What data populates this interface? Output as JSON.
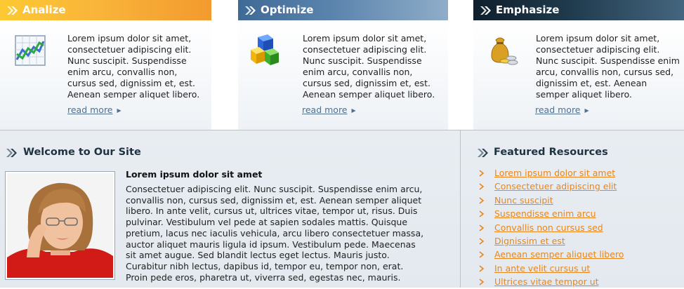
{
  "features": [
    {
      "title": "Analize",
      "icon": "chart-icon",
      "text": "Lorem ipsum dolor sit amet, consectetuer adipiscing elit. Nunc suscipit. Suspendisse enim arcu, convallis non, cursus sed, dignissim et, est. Aenean semper aliquet libero.",
      "link": "read more"
    },
    {
      "title": "Optimize",
      "icon": "cubes-icon",
      "text": "Lorem ipsum dolor sit amet, consectetuer adipiscing elit. Nunc suscipit. Suspendisse enim arcu, convallis non, cursus sed, dignissim et, est. Aenean semper aliquet libero.",
      "link": "read more"
    },
    {
      "title": "Emphasize",
      "icon": "money-bag-icon",
      "text": "Lorem ipsum dolor sit amet, consectetuer adipiscing elit. Nunc suscipit. Suspendisse enim arcu, convallis non, cursus sed, dignissim et, est. Aenean semper aliquet libero.",
      "link": "read more"
    }
  ],
  "welcome": {
    "title": "Welcome to Our Site",
    "heading": "Lorem ipsum dolor sit amet",
    "body": "Consectetuer adipiscing elit. Nunc suscipit. Suspendisse enim arcu, convallis non, cursus sed, dignissim et, est. Aenean semper aliquet libero. In ante velit, cursus ut, ultrices vitae, tempor ut, risus. Duis pulvinar. Vestibulum vel pede at sapien sodales mattis. Quisque pretium, lacus nec iaculis vehicula, arcu libero consectetuer massa, auctor aliquet mauris ligula id ipsum. Vestibulum pede. Maecenas sit amet augue. Sed blandit lectus eget lectus. Mauris justo. Curabitur nibh lectus, dapibus id, tempor eu, tempor non, erat. Proin pede eros, pharetra ut, viverra sed, egestas nec, mauris."
  },
  "featured": {
    "title": "Featured Resources",
    "items": [
      "Lorem ipsum dolor sit amet",
      "Consectetuer adipiscing elit",
      "Nunc suscipit",
      "Suspendisse enim arcu",
      "Convallis non cursus sed",
      "Dignissim et est",
      "Aenean semper aliquet libero",
      "In ante velit cursus ut",
      "Ultrices vitae tempor ut"
    ]
  },
  "colors": {
    "analize_header": "#f9b53a",
    "optimize_header": "#5b84ad",
    "emphasize_header": "#1f3a4d",
    "link_orange": "#e8861c",
    "readmore_blue": "#50708c"
  }
}
